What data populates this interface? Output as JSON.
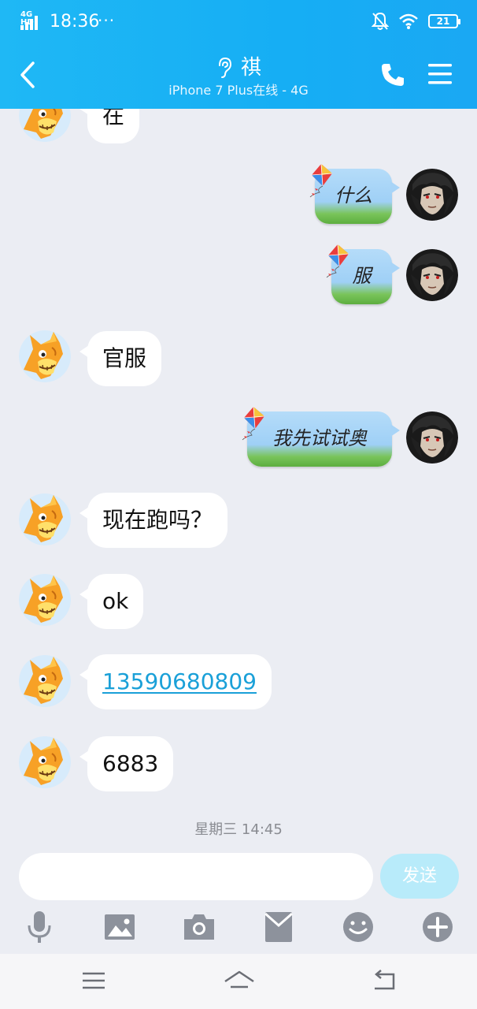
{
  "status_bar": {
    "network": "4G HD",
    "time": "18:36",
    "more_indicator": "···",
    "battery": "21",
    "icons": [
      "signal-icon",
      "mute-icon",
      "wifi-icon",
      "battery-icon"
    ]
  },
  "header": {
    "contact_name": "祺",
    "contact_status": "iPhone 7 Plus在线 - 4G",
    "icons": [
      "back-icon",
      "ear-icon",
      "phone-icon",
      "menu-icon"
    ],
    "background": "#16aef4"
  },
  "messages": [
    {
      "from": "contact",
      "type": "text",
      "text": "在"
    },
    {
      "from": "me",
      "type": "kite-bubble",
      "text": "什么"
    },
    {
      "from": "me",
      "type": "kite-bubble",
      "text": "服"
    },
    {
      "from": "contact",
      "type": "text",
      "text": "官服"
    },
    {
      "from": "me",
      "type": "kite-bubble",
      "text": "我先试试奥"
    },
    {
      "from": "contact",
      "type": "text",
      "text": "现在跑吗？"
    },
    {
      "from": "contact",
      "type": "text",
      "text": "ok"
    },
    {
      "from": "contact",
      "type": "link",
      "text": "13590680809"
    },
    {
      "from": "contact",
      "type": "text",
      "text": "6883"
    }
  ],
  "timestamp": "星期三 14:45",
  "input": {
    "value": "",
    "send_label": "发送"
  },
  "toolbar": [
    "microphone-icon",
    "image-icon",
    "camera-icon",
    "red-packet-icon",
    "emoji-icon",
    "plus-icon"
  ],
  "nav": [
    "menu-nav-icon",
    "home-nav-icon",
    "back-nav-icon"
  ],
  "colors": {
    "chat_background": "#ebedf3",
    "bubble": "#ffffff",
    "link": "#1aa0d8",
    "send_button": "#b8ebfa",
    "toolbar_icon": "#8d929c"
  }
}
